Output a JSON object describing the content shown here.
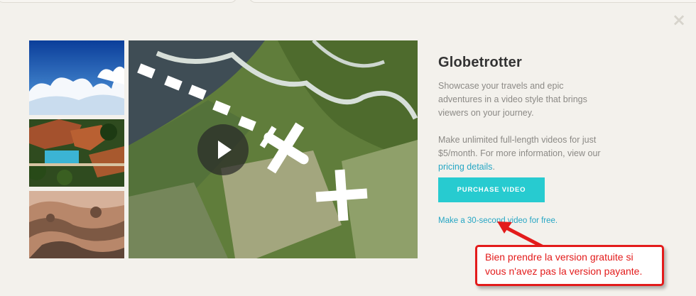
{
  "window": {
    "close_icon": "×"
  },
  "video": {
    "thumbnails": [
      {
        "name": "sky-clouds",
        "alt": ""
      },
      {
        "name": "mansion-pool",
        "alt": ""
      },
      {
        "name": "desert-aerial",
        "alt": ""
      }
    ],
    "main_scene": "aerial-river-map-with-plane-route",
    "play_icon": "play-icon"
  },
  "info": {
    "title": "Globetrotter",
    "description": "Showcase your travels and epic adventures in a video style that brings viewers on your journey.",
    "pricing_text_before": "Make unlimited full-length videos for just $5/month. For more information, view our ",
    "pricing_link": "pricing details",
    "pricing_text_after": ".",
    "purchase_button": "PURCHASE VIDEO",
    "free_link": "Make a 30-second video for free."
  },
  "annotation": {
    "line1": "Bien prendre la version gratuite si",
    "line2": "vous n'avez pas la version payante."
  },
  "colors": {
    "accent": "#27cbd0",
    "link": "#26a6c4",
    "annotation": "#e31b1b"
  }
}
